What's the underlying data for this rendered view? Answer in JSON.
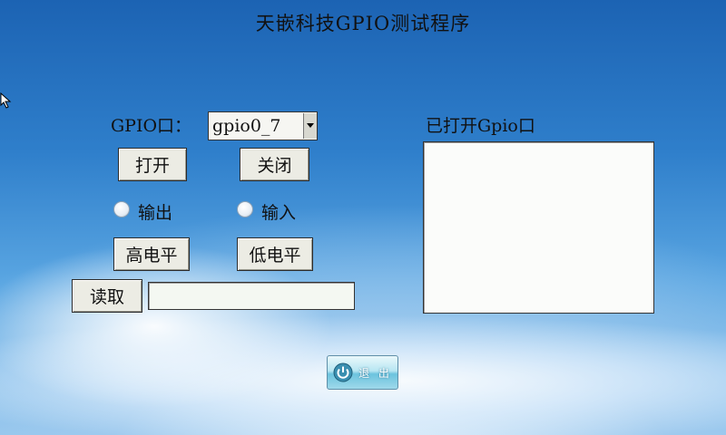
{
  "title": "天嵌科技GPIO测试程序",
  "gpio": {
    "label": "GPIO口：",
    "selected": "gpio0_7",
    "open_label": "打开",
    "close_label": "关闭",
    "output_label": "输出",
    "input_label": "输入",
    "high_label": "高电平",
    "low_label": "低电平",
    "read_label": "读取",
    "read_value": ""
  },
  "opened_panel": {
    "label": "已打开Gpio口",
    "items": []
  },
  "exit_label": "退 出",
  "colors": {
    "button_face": "#ecece4",
    "exit_accent": "#6cc3de"
  },
  "icons": [
    "mouse-cursor-icon",
    "dropdown-arrow-icon",
    "power-icon"
  ]
}
